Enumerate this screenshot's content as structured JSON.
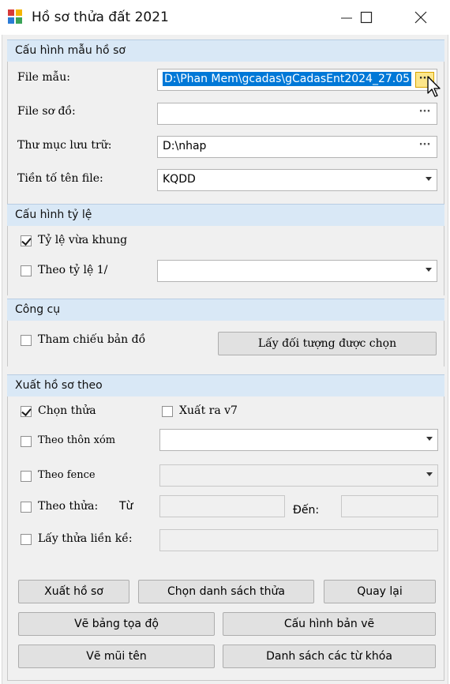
{
  "window": {
    "title": "Hồ sơ thửa đất 2021"
  },
  "sections": {
    "template": {
      "header": "Cấu hình mẫu hồ sơ",
      "file_mau_label": "File mẫu:",
      "file_mau_value": "D:\\Phan Mem\\gcadas\\gCadasEnt2024_27.05",
      "file_so_do_label": "File sơ đồ:",
      "file_so_do_value": "",
      "thu_muc_label": "Thư mục lưu trữ:",
      "thu_muc_value": "D:\\nhap",
      "tien_to_label": "Tiền tố tên file:",
      "tien_to_value": "KQDD",
      "browse_label": "···"
    },
    "scale": {
      "header": "Cấu hình tỷ lệ",
      "fit_label": "Tỷ lệ vừa khung",
      "fit_checked": true,
      "by_scale_label": "Theo tỷ lệ 1/",
      "by_scale_checked": false,
      "by_scale_value": ""
    },
    "tools": {
      "header": "Công cụ",
      "reference_label": "Tham chiếu bản đồ",
      "reference_checked": false,
      "get_selected_button": "Lấy đối tượng được chọn"
    },
    "export": {
      "header": "Xuất hồ sơ theo",
      "select_parcel_label": "Chọn thửa",
      "select_parcel_checked": true,
      "export_v7_label": "Xuất ra v7",
      "export_v7_checked": false,
      "by_hamlet_label": "Theo thôn xóm",
      "by_fence_label": "Theo fence",
      "by_parcel_label": "Theo thửa:",
      "from_label": "Từ",
      "to_label": "Đến:",
      "adjacent_label": "Lấy thửa liền kề:"
    }
  },
  "buttons": {
    "export_profile": "Xuất hồ sơ",
    "choose_list": "Chọn danh sách thửa",
    "back": "Quay lại",
    "draw_coord_table": "Vẽ bảng tọa độ",
    "drawing_config": "Cấu hình bản vẽ",
    "draw_arrow": "Vẽ mũi tên",
    "keyword_list": "Danh sách các từ khóa"
  },
  "colors": {
    "section_header_bg": "#d9e8f6",
    "selection_highlight": "#0078d7",
    "active_browse_bg": "#fde68a"
  }
}
